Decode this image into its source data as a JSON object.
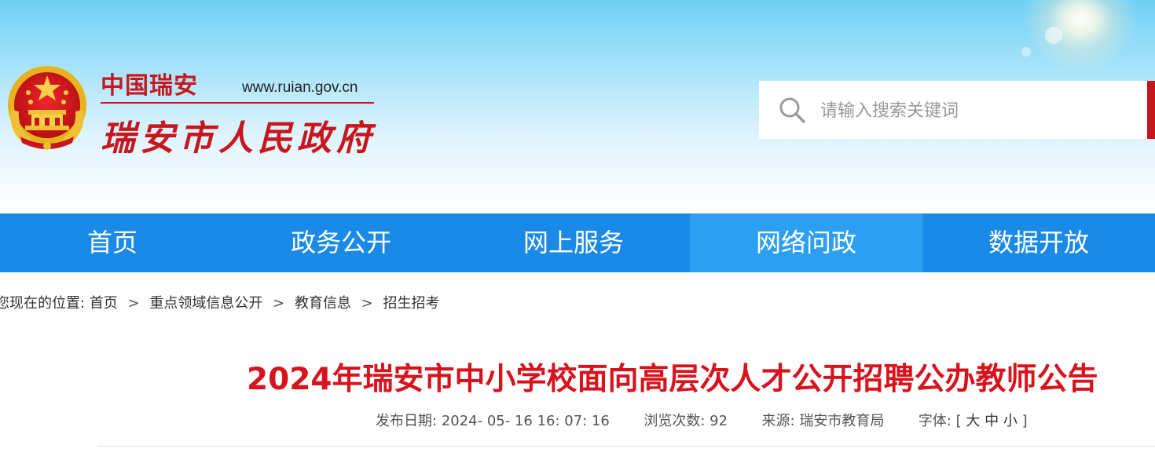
{
  "header": {
    "brand_small": "中国瑞安",
    "brand_url": "www.ruian.gov.cn",
    "brand_main": "瑞安市人民政府",
    "colors": {
      "brand_red": "#c8161d",
      "nav_blue": "#1a8ae6",
      "nav_active": "#2c9ff3",
      "title_red": "#d7141d"
    }
  },
  "search": {
    "placeholder": "请输入搜索关键词",
    "icon": "search-icon"
  },
  "nav": {
    "items": [
      "首页",
      "政务公开",
      "网上服务",
      "网络问政",
      "数据开放"
    ],
    "active_item": "网络问政"
  },
  "breadcrumb": {
    "lead": "您现在的位置:",
    "items": [
      "首页",
      "重点领域信息公开",
      "教育信息",
      "招生招考"
    ],
    "separator": ">"
  },
  "article": {
    "title": "2024年瑞安市中小学校面向高层次人才公开招聘公办教师公告",
    "publish_label": "发布日期:",
    "publish_value": "2024- 05- 16 16: 07: 16",
    "views_label": "浏览次数:",
    "views_value": "92",
    "source_label": "来源:",
    "source_value": "瑞安市教育局",
    "font_label": "字体:",
    "font_open": "[",
    "font_large": "大",
    "font_medium": "中",
    "font_small": "小",
    "font_close": "]"
  }
}
